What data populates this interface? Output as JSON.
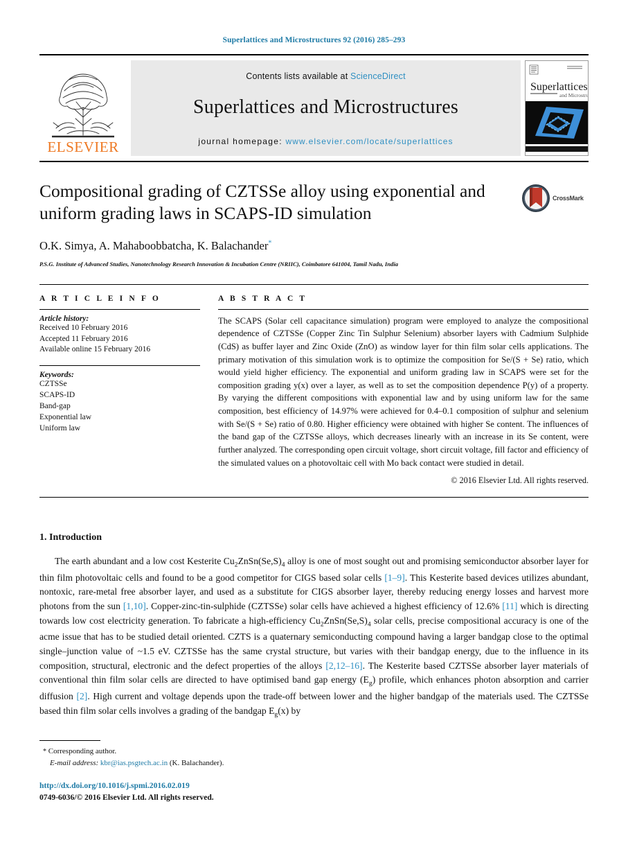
{
  "running_head": "Superlattices and Microstructures 92 (2016) 285–293",
  "banner": {
    "publisher_name": "ELSEVIER",
    "publisher_logo": "elsevier-tree-logo",
    "contents_prefix": "Contents lists available at ",
    "contents_link": "ScienceDirect",
    "journal_name": "Superlattices and Microstructures",
    "homepage_prefix": "journal homepage: ",
    "homepage_url": "www.elsevier.com/locate/superlattices",
    "cover_title": "Superlattices",
    "cover_subtitle": "and Microstructures"
  },
  "article": {
    "title": "Compositional grading of CZTSSe alloy using exponential and uniform grading laws in SCAPS-ID simulation",
    "crossmark_label": "CrossMark",
    "crossmark_icon": "crossmark-icon",
    "authors": "O.K. Simya, A. Mahaboobbatcha, K. Balachander",
    "corresponding_marker": "*",
    "affiliation": "P.S.G. Institute of Advanced Studies, Nanotechnology Research Innovation & Incubation Centre (NRIIC), Coimbatore 641004, Tamil Nadu, India"
  },
  "article_info": {
    "heading": "A R T I C L E  I N F O",
    "history_label": "Article history:",
    "history": [
      "Received 10 February 2016",
      "Accepted 11 February 2016",
      "Available online 15 February 2016"
    ],
    "keywords_label": "Keywords:",
    "keywords": [
      "CZTSSe",
      "SCAPS-ID",
      "Band-gap",
      "Exponential law",
      "Uniform law"
    ]
  },
  "abstract": {
    "heading": "A B S T R A C T",
    "body": "The SCAPS (Solar cell capacitance simulation) program were employed to analyze the compositional dependence of CZTSSe (Copper Zinc Tin Sulphur Selenium) absorber layers with Cadmium Sulphide (CdS) as buffer layer and Zinc Oxide (ZnO) as window layer for thin film solar cells applications. The primary motivation of this simulation work is to optimize the composition for Se/(S + Se) ratio, which would yield higher efficiency. The exponential and uniform grading law in SCAPS were set for the composition grading y(x) over a layer, as well as to set the composition dependence P(y) of a property. By varying the different compositions with exponential law and by using uniform law for the same composition, best efficiency of 14.97% were achieved for 0.4–0.1 composition of sulphur and selenium with Se/(S + Se) ratio of 0.80. Higher efficiency were obtained with higher Se content. The influences of the band gap of the CZTSSe alloys, which decreases linearly with an increase in its Se content, were further analyzed. The corresponding open circuit voltage, short circuit voltage, fill factor and efficiency of the simulated values on a photovoltaic cell with Mo back contact were studied in detail.",
    "copyright": "© 2016 Elsevier Ltd. All rights reserved."
  },
  "introduction": {
    "heading": "1. Introduction",
    "paragraph_parts": [
      "The earth abundant and a low cost Kesterite Cu",
      "2",
      "ZnSn(Se,S)",
      "4",
      " alloy is one of most sought out and promising semiconductor absorber layer for thin film photovoltaic cells and found to be a good competitor for CIGS based solar cells ",
      "[1–9]",
      ". This Kesterite based devices utilizes abundant, nontoxic, rare-metal free absorber layer, and used as a substitute for CIGS absorber layer, thereby reducing energy losses and harvest more photons from the sun ",
      "[1,10]",
      ". Copper-zinc-tin-sulphide (CZTSSe) solar cells have achieved a highest efficiency of 12.6% ",
      "[11]",
      " which is directing towards low cost electricity generation. To fabricate a high-efficiency Cu",
      "2",
      "ZnSn(Se,S)",
      "4",
      " solar cells, precise compositional accuracy is one of the acme issue that has to be studied detail oriented. CZTS is a quaternary semiconducting compound having a larger bandgap close to the optimal single–junction value of ~1.5 eV. CZTSSe has the same crystal structure, but varies with their bandgap energy, due to the influence in its composition, structural, electronic and the defect properties of the alloys ",
      "[2,12–16]",
      ". The Kesterite based CZTSSe absorber layer materials of conventional thin film solar cells are directed to have optimised band gap energy (E",
      "g",
      ") profile, which enhances photon absorption and carrier diffusion ",
      "[2]",
      ". High current and voltage depends upon the trade-off between lower and the higher bandgap of the materials used. The CZTSSe based thin film solar cells involves a grading of the bandgap E",
      "g",
      "(x) by"
    ]
  },
  "footer": {
    "corresponding_star": "*",
    "corresponding_label": "Corresponding author.",
    "email_label": "E-mail address:",
    "email": "kbr@ias.psgtech.ac.in",
    "email_owner": "(K. Balachander).",
    "doi": "http://dx.doi.org/10.1016/j.spmi.2016.02.019",
    "issn_line": "0749-6036/© 2016 Elsevier Ltd. All rights reserved."
  },
  "colors": {
    "link": "#1f7ba6",
    "science_direct": "#2e8fc2",
    "elsevier_orange": "#ee7822",
    "banner_bg": "#e9e9e9"
  }
}
